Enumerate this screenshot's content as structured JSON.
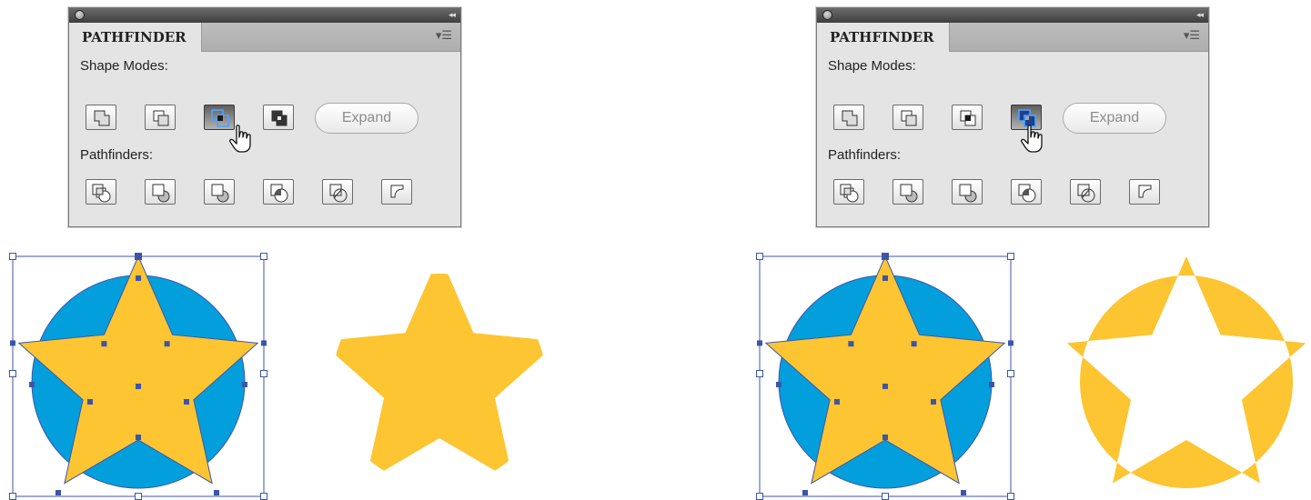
{
  "panels": [
    {
      "tab_label": "PATHFINDER",
      "shape_modes_label": "Shape Modes:",
      "pathfinders_label": "Pathfinders:",
      "expand_label": "Expand",
      "shape_mode_buttons": [
        "unite-icon",
        "minus-front-icon",
        "intersect-icon",
        "exclude-icon"
      ],
      "active_shape_mode": "intersect-icon",
      "pathfinder_buttons": [
        "divide-icon",
        "trim-icon",
        "merge-icon",
        "crop-icon",
        "outline-icon",
        "minus-back-icon"
      ]
    },
    {
      "tab_label": "PATHFINDER",
      "shape_modes_label": "Shape Modes:",
      "pathfinders_label": "Pathfinders:",
      "expand_label": "Expand",
      "shape_mode_buttons": [
        "unite-icon",
        "minus-front-icon",
        "intersect-icon",
        "exclude-icon"
      ],
      "active_shape_mode": "exclude-icon",
      "pathfinder_buttons": [
        "divide-icon",
        "trim-icon",
        "merge-icon",
        "crop-icon",
        "outline-icon",
        "minus-back-icon"
      ]
    }
  ],
  "colors": {
    "circle_fill": "#039fdc",
    "star_fill": "#fcc531",
    "selection_stroke": "#3d55a8",
    "anchor_point": "#3d55a8"
  },
  "illustrations": [
    {
      "before": "selected-star-over-circle",
      "after": "intersect-result-star"
    },
    {
      "before": "selected-star-over-circle",
      "after": "exclude-result-circle-with-star-hole"
    }
  ]
}
